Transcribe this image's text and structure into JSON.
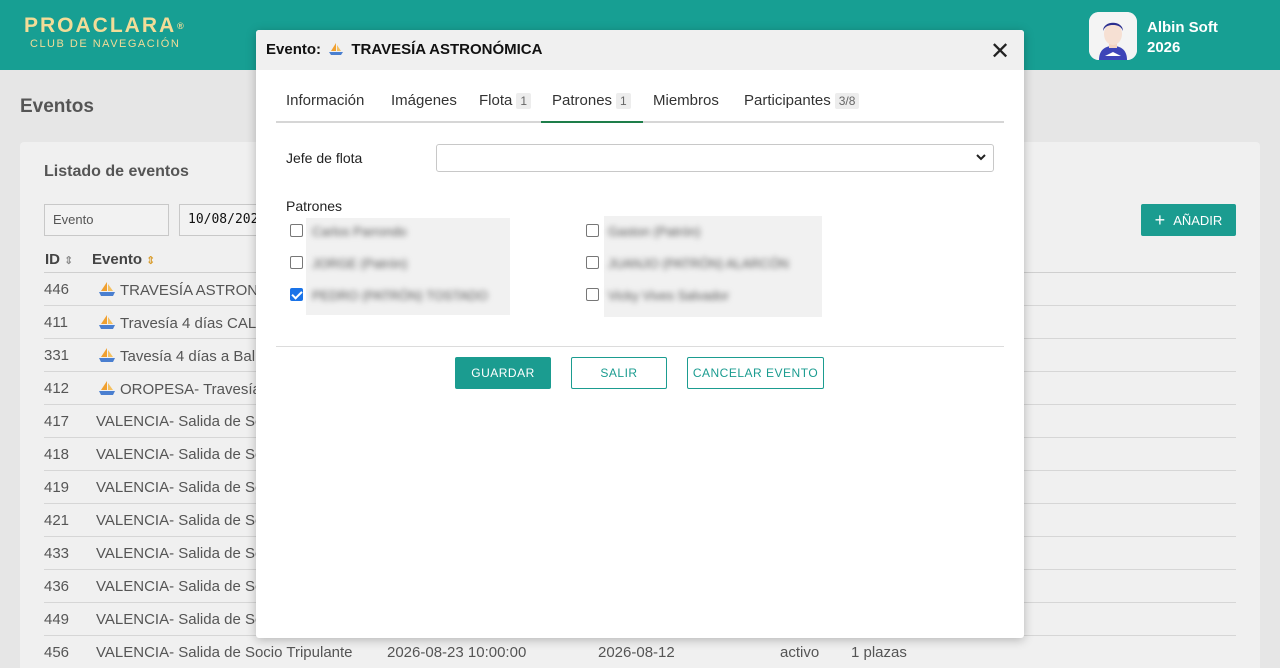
{
  "header": {
    "logo_main": "PROACLARA",
    "logo_mark": "®",
    "logo_sub": "CLUB DE NAVEGACIÓN",
    "user_name": "Albin Soft",
    "user_year": "2026"
  },
  "page": {
    "title": "Eventos",
    "list_title": "Listado de eventos",
    "filter_event_placeholder": "Evento",
    "filter_date_value": "10/08/202",
    "add_button": "AÑADIR",
    "columns": {
      "id": "ID",
      "event": "Evento"
    },
    "rows": [
      {
        "id": "446",
        "name": "TRAVESÍA ASTRONÓ",
        "boat": true
      },
      {
        "id": "411",
        "name": "Travesía 4 días CAL",
        "boat": true
      },
      {
        "id": "331",
        "name": "Tavesía 4 días a Bal",
        "boat": true
      },
      {
        "id": "412",
        "name": "OROPESA- Travesía",
        "boat": true
      },
      {
        "id": "417",
        "name": "VALENCIA- Salida de Soc",
        "boat": false
      },
      {
        "id": "418",
        "name": "VALENCIA- Salida de Soc",
        "boat": false
      },
      {
        "id": "419",
        "name": "VALENCIA- Salida de Soc",
        "boat": false
      },
      {
        "id": "421",
        "name": "VALENCIA- Salida de Soc",
        "boat": false
      },
      {
        "id": "433",
        "name": "VALENCIA- Salida de Soc",
        "boat": false
      },
      {
        "id": "436",
        "name": "VALENCIA- Salida de Soc",
        "boat": false
      },
      {
        "id": "449",
        "name": "VALENCIA- Salida de Soc",
        "boat": false
      },
      {
        "id": "456",
        "name": "VALENCIA- Salida de Socio Tripulante",
        "boat": false,
        "start": "2026-08-23 10:00:00",
        "date": "2026-08-12",
        "status": "activo",
        "seats": "1 plazas"
      }
    ]
  },
  "modal": {
    "title_prefix": "Evento:",
    "title_name": "TRAVESÍA ASTRONÓMICA",
    "close_symbol": "✕",
    "tabs": [
      {
        "label": "Información",
        "badge": ""
      },
      {
        "label": "Imágenes",
        "badge": ""
      },
      {
        "label": "Flota",
        "badge": "1"
      },
      {
        "label": "Patrones",
        "badge": "1"
      },
      {
        "label": "Miembros",
        "badge": ""
      },
      {
        "label": "Participantes",
        "badge": "3/8"
      }
    ],
    "active_tab": "Patrones",
    "jefe_label": "Jefe de flota",
    "jefe_value": "",
    "patrones_label": "Patrones",
    "patrones": [
      {
        "name": "Carlos Parrondo",
        "checked": false
      },
      {
        "name": "JORGE (Patrón)",
        "checked": false
      },
      {
        "name": "PEDRO (PATRÓN) TOSTADO",
        "checked": true
      },
      {
        "name": "Gaston (Patrón)",
        "checked": false
      },
      {
        "name": "JUANJO (PATRÓN) ALARCÓN",
        "checked": false
      },
      {
        "name": "Vicky Vives Salvador",
        "checked": false
      }
    ],
    "buttons": {
      "save": "GUARDAR",
      "exit": "SALIR",
      "cancel_event": "CANCELAR EVENTO"
    }
  },
  "colors": {
    "brand": "#179f93",
    "logo": "#f2dc98",
    "button": "#1b9c90",
    "active_tab": "#1e7e4a"
  }
}
